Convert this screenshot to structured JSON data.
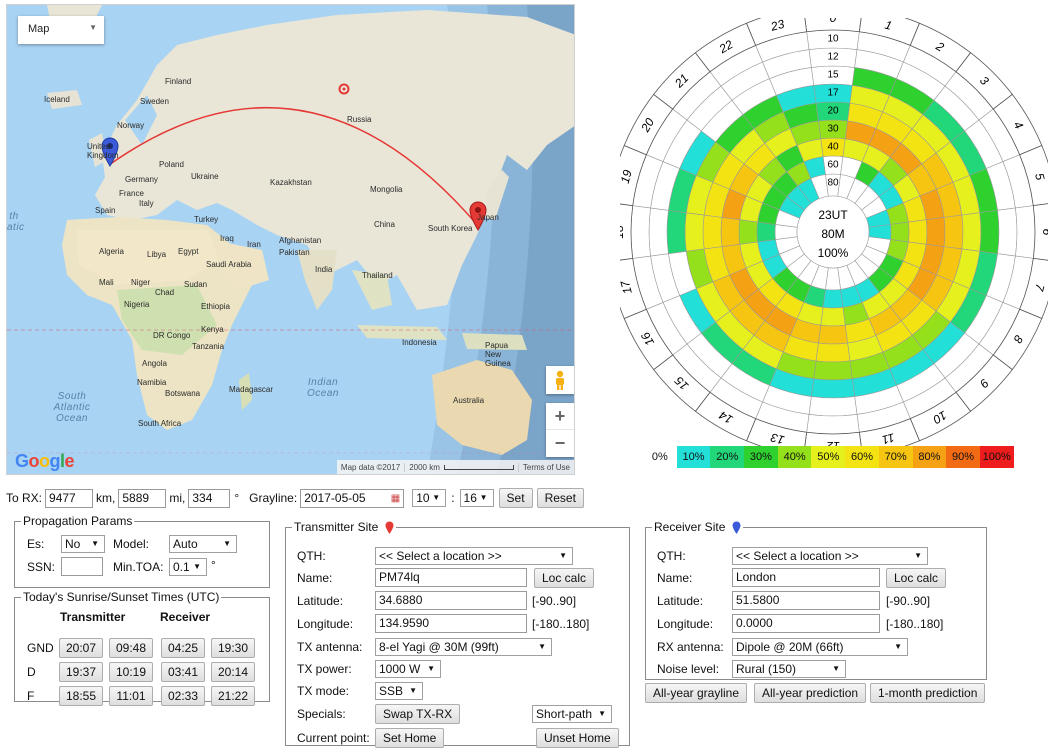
{
  "map": {
    "type_label": "Map",
    "labels": {
      "iceland": "Iceland",
      "finland": "Finland",
      "sweden": "Sweden",
      "norway": "Norway",
      "united_kingdom": "United Kingdom",
      "germany": "Germany",
      "france": "France",
      "spain": "Spain",
      "italy": "Italy",
      "ukraine": "Ukraine",
      "poland": "Poland",
      "turkey": "Turkey",
      "russia": "Russia",
      "kazakhstan": "Kazakhstan",
      "mongolia": "Mongolia",
      "china": "China",
      "japan": "Japan",
      "south_korea": "South Korea",
      "iraq": "Iraq",
      "iran": "Iran",
      "afghanistan": "Afghanistan",
      "pakistan": "Pakistan",
      "india": "India",
      "thailand": "Thailand",
      "saudi_arabia": "Saudi Arabia",
      "egypt": "Egypt",
      "libya": "Libya",
      "algeria": "Algeria",
      "mali": "Mali",
      "niger": "Niger",
      "chad": "Chad",
      "sudan": "Sudan",
      "nigeria": "Nigeria",
      "ethiopia": "Ethiopia",
      "kenya": "Kenya",
      "dr_congo": "DR Congo",
      "tanzania": "Tanzania",
      "angola": "Angola",
      "namibia": "Namibia",
      "botswana": "Botswana",
      "madagascar": "Madagascar",
      "south_africa": "South Africa",
      "indonesia": "Indonesia",
      "papua": "Papua New Guinea",
      "australia": "Australia",
      "indian_ocean": "Indian Ocean",
      "south_atlantic": "South Atlantic Ocean",
      "atlantic": "th atic"
    },
    "google": "Google",
    "attribution": {
      "data": "Map data ©2017",
      "scale": "2000 km",
      "terms": "Terms of Use"
    }
  },
  "polar": {
    "center": {
      "hour": "23UT",
      "band": "80M",
      "reliability": "100%"
    },
    "hours": [
      "0",
      "1",
      "2",
      "3",
      "4",
      "5",
      "6",
      "7",
      "8",
      "9",
      "10",
      "11",
      "12",
      "13",
      "14",
      "15",
      "16",
      "17",
      "18",
      "19",
      "20",
      "21",
      "22",
      "23"
    ],
    "bands": [
      "10",
      "12",
      "15",
      "17",
      "20",
      "30",
      "40",
      "60",
      "80"
    ],
    "legend": [
      {
        "label": "0%",
        "color": "#ffffff"
      },
      {
        "label": "10%",
        "color": "#22e0d8"
      },
      {
        "label": "20%",
        "color": "#22d67a"
      },
      {
        "label": "30%",
        "color": "#2fd12f"
      },
      {
        "label": "40%",
        "color": "#94e01a"
      },
      {
        "label": "50%",
        "color": "#e6f01c"
      },
      {
        "label": "60%",
        "color": "#f3e312"
      },
      {
        "label": "70%",
        "color": "#f5c512"
      },
      {
        "label": "80%",
        "color": "#f5a114"
      },
      {
        "label": "90%",
        "color": "#f36a14"
      },
      {
        "label": "100%",
        "color": "#ee1c1c"
      }
    ]
  },
  "route": {
    "to_rx_label": "To RX:",
    "km_value": "9477",
    "km_unit": "km,",
    "mi_value": "5889",
    "mi_unit": "mi,",
    "deg_value": "334",
    "deg_unit": "°",
    "grayline_label": "Grayline:",
    "date": "2017-05-05",
    "hour": "10",
    "colon": ":",
    "minute": "16",
    "set": "Set",
    "reset": "Reset"
  },
  "propagation": {
    "title": "Propagation Params",
    "es_label": "Es:",
    "es_value": "No",
    "model_label": "Model:",
    "model_value": "Auto",
    "ssn_label": "SSN:",
    "ssn_value": "",
    "toa_label": "Min.TOA:",
    "toa_value": "0.1",
    "toa_unit": "°"
  },
  "sun": {
    "title": "Today's Sunrise/Sunset Times (UTC)",
    "tx_header": "Transmitter",
    "rx_header": "Receiver",
    "rows": [
      {
        "label": "GND",
        "values": [
          "20:07",
          "09:48",
          "04:25",
          "19:30"
        ]
      },
      {
        "label": "D",
        "values": [
          "19:37",
          "10:19",
          "03:41",
          "20:14"
        ]
      },
      {
        "label": "F",
        "values": [
          "18:55",
          "11:01",
          "02:33",
          "21:22"
        ]
      }
    ]
  },
  "tx": {
    "title": "Transmitter Site",
    "qth_label": "QTH:",
    "qth_value": "<< Select a location >>",
    "name_label": "Name:",
    "name_value": "PM74lq",
    "loc_calc": "Loc calc",
    "lat_label": "Latitude:",
    "lat_value": "34.6880",
    "lat_range": "[-90..90]",
    "lon_label": "Longitude:",
    "lon_value": "134.9590",
    "lon_range": "[-180..180]",
    "antenna_label": "TX antenna:",
    "antenna_value": "8-el Yagi @ 30M (99ft)",
    "power_label": "TX power:",
    "power_value": "1000 W",
    "mode_label": "TX mode:",
    "mode_value": "SSB",
    "specials_label": "Specials:",
    "swap": "Swap TX-RX",
    "path_value": "Short-path",
    "current_label": "Current point:",
    "set_home": "Set Home",
    "unset_home": "Unset Home",
    "pin_color": "#e53935"
  },
  "rx": {
    "title": "Receiver Site",
    "qth_label": "QTH:",
    "qth_value": "<< Select a location >>",
    "name_label": "Name:",
    "name_value": "London",
    "loc_calc": "Loc calc",
    "lat_label": "Latitude:",
    "lat_value": "51.5800",
    "lat_range": "[-90..90]",
    "lon_label": "Longitude:",
    "lon_value": "0.0000",
    "lon_range": "[-180..180]",
    "antenna_label": "RX antenna:",
    "antenna_value": "Dipole @ 20M (66ft)",
    "noise_label": "Noise level:",
    "noise_value": "Rural (150)",
    "pin_color": "#3b5bdb"
  },
  "actions": {
    "grayline": "All-year grayline",
    "prediction": "All-year prediction",
    "month": "1-month prediction"
  }
}
